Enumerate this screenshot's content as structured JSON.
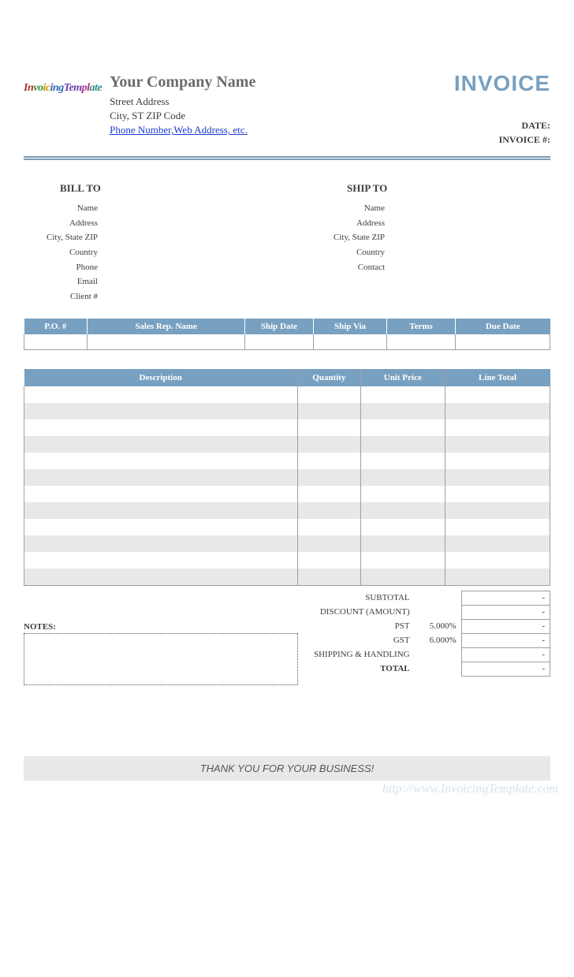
{
  "header": {
    "logo_text": "InvoicingTemplate",
    "company_name": "Your Company Name",
    "street": "Street Address",
    "city_line": "City, ST  ZIP Code",
    "contact_link": "Phone Number,Web Address, etc.",
    "invoice_title": "INVOICE",
    "date_label": "DATE:",
    "invoice_no_label": "INVOICE #:"
  },
  "bill_to": {
    "title": "BILL TO",
    "fields": [
      "Name",
      "Address",
      "City, State ZIP",
      "Country",
      "Phone",
      "Email",
      "Client #"
    ]
  },
  "ship_to": {
    "title": "SHIP TO",
    "fields": [
      "Name",
      "Address",
      "City, State ZIP",
      "Country",
      "Contact"
    ]
  },
  "meta_table": {
    "headers": [
      "P.O. #",
      "Sales Rep. Name",
      "Ship Date",
      "Ship Via",
      "Terms",
      "Due Date"
    ]
  },
  "items_table": {
    "headers": {
      "description": "Description",
      "quantity": "Quantity",
      "unit_price": "Unit Price",
      "line_total": "Line Total"
    },
    "row_count": 12
  },
  "totals": {
    "subtotal_label": "SUBTOTAL",
    "subtotal_value": "-",
    "discount_label": "DISCOUNT (AMOUNT)",
    "discount_value": "-",
    "pst_label": "PST",
    "pst_rate": "5.000%",
    "pst_value": "-",
    "gst_label": "GST",
    "gst_rate": "6.000%",
    "gst_value": "-",
    "shipping_label": "SHIPPING & HANDLING",
    "shipping_value": "-",
    "total_label": "TOTAL",
    "total_value": "-"
  },
  "notes_label": "NOTES:",
  "thank_you": "THANK YOU FOR YOUR BUSINESS!",
  "watermark": "http://www.InvoicingTemplate.com"
}
